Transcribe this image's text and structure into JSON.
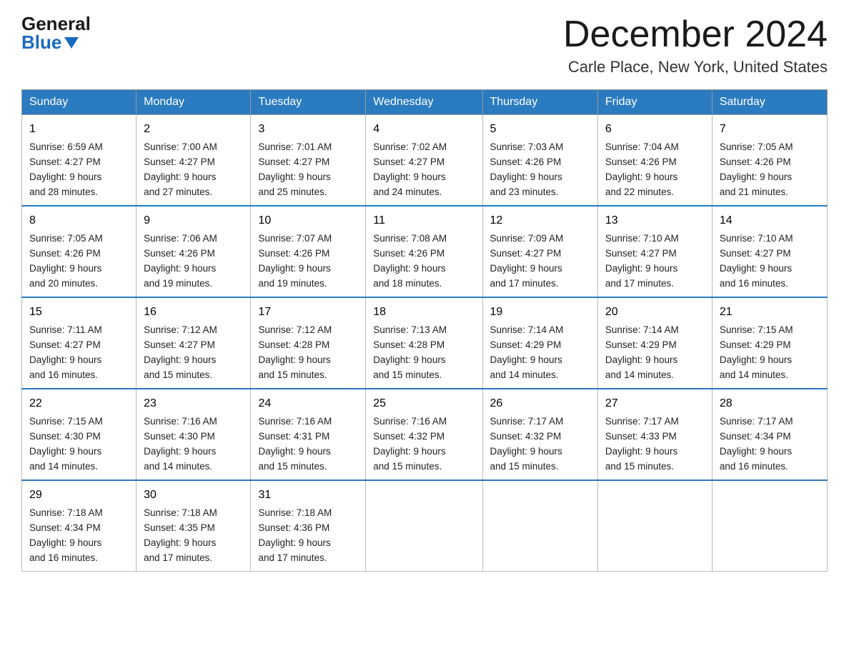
{
  "logo": {
    "general": "General",
    "blue": "Blue"
  },
  "title": "December 2024",
  "location": "Carle Place, New York, United States",
  "days_of_week": [
    "Sunday",
    "Monday",
    "Tuesday",
    "Wednesday",
    "Thursday",
    "Friday",
    "Saturday"
  ],
  "weeks": [
    [
      {
        "day": "1",
        "sunrise": "Sunrise: 6:59 AM",
        "sunset": "Sunset: 4:27 PM",
        "daylight": "Daylight: 9 hours",
        "daylight2": "and 28 minutes."
      },
      {
        "day": "2",
        "sunrise": "Sunrise: 7:00 AM",
        "sunset": "Sunset: 4:27 PM",
        "daylight": "Daylight: 9 hours",
        "daylight2": "and 27 minutes."
      },
      {
        "day": "3",
        "sunrise": "Sunrise: 7:01 AM",
        "sunset": "Sunset: 4:27 PM",
        "daylight": "Daylight: 9 hours",
        "daylight2": "and 25 minutes."
      },
      {
        "day": "4",
        "sunrise": "Sunrise: 7:02 AM",
        "sunset": "Sunset: 4:27 PM",
        "daylight": "Daylight: 9 hours",
        "daylight2": "and 24 minutes."
      },
      {
        "day": "5",
        "sunrise": "Sunrise: 7:03 AM",
        "sunset": "Sunset: 4:26 PM",
        "daylight": "Daylight: 9 hours",
        "daylight2": "and 23 minutes."
      },
      {
        "day": "6",
        "sunrise": "Sunrise: 7:04 AM",
        "sunset": "Sunset: 4:26 PM",
        "daylight": "Daylight: 9 hours",
        "daylight2": "and 22 minutes."
      },
      {
        "day": "7",
        "sunrise": "Sunrise: 7:05 AM",
        "sunset": "Sunset: 4:26 PM",
        "daylight": "Daylight: 9 hours",
        "daylight2": "and 21 minutes."
      }
    ],
    [
      {
        "day": "8",
        "sunrise": "Sunrise: 7:05 AM",
        "sunset": "Sunset: 4:26 PM",
        "daylight": "Daylight: 9 hours",
        "daylight2": "and 20 minutes."
      },
      {
        "day": "9",
        "sunrise": "Sunrise: 7:06 AM",
        "sunset": "Sunset: 4:26 PM",
        "daylight": "Daylight: 9 hours",
        "daylight2": "and 19 minutes."
      },
      {
        "day": "10",
        "sunrise": "Sunrise: 7:07 AM",
        "sunset": "Sunset: 4:26 PM",
        "daylight": "Daylight: 9 hours",
        "daylight2": "and 19 minutes."
      },
      {
        "day": "11",
        "sunrise": "Sunrise: 7:08 AM",
        "sunset": "Sunset: 4:26 PM",
        "daylight": "Daylight: 9 hours",
        "daylight2": "and 18 minutes."
      },
      {
        "day": "12",
        "sunrise": "Sunrise: 7:09 AM",
        "sunset": "Sunset: 4:27 PM",
        "daylight": "Daylight: 9 hours",
        "daylight2": "and 17 minutes."
      },
      {
        "day": "13",
        "sunrise": "Sunrise: 7:10 AM",
        "sunset": "Sunset: 4:27 PM",
        "daylight": "Daylight: 9 hours",
        "daylight2": "and 17 minutes."
      },
      {
        "day": "14",
        "sunrise": "Sunrise: 7:10 AM",
        "sunset": "Sunset: 4:27 PM",
        "daylight": "Daylight: 9 hours",
        "daylight2": "and 16 minutes."
      }
    ],
    [
      {
        "day": "15",
        "sunrise": "Sunrise: 7:11 AM",
        "sunset": "Sunset: 4:27 PM",
        "daylight": "Daylight: 9 hours",
        "daylight2": "and 16 minutes."
      },
      {
        "day": "16",
        "sunrise": "Sunrise: 7:12 AM",
        "sunset": "Sunset: 4:27 PM",
        "daylight": "Daylight: 9 hours",
        "daylight2": "and 15 minutes."
      },
      {
        "day": "17",
        "sunrise": "Sunrise: 7:12 AM",
        "sunset": "Sunset: 4:28 PM",
        "daylight": "Daylight: 9 hours",
        "daylight2": "and 15 minutes."
      },
      {
        "day": "18",
        "sunrise": "Sunrise: 7:13 AM",
        "sunset": "Sunset: 4:28 PM",
        "daylight": "Daylight: 9 hours",
        "daylight2": "and 15 minutes."
      },
      {
        "day": "19",
        "sunrise": "Sunrise: 7:14 AM",
        "sunset": "Sunset: 4:29 PM",
        "daylight": "Daylight: 9 hours",
        "daylight2": "and 14 minutes."
      },
      {
        "day": "20",
        "sunrise": "Sunrise: 7:14 AM",
        "sunset": "Sunset: 4:29 PM",
        "daylight": "Daylight: 9 hours",
        "daylight2": "and 14 minutes."
      },
      {
        "day": "21",
        "sunrise": "Sunrise: 7:15 AM",
        "sunset": "Sunset: 4:29 PM",
        "daylight": "Daylight: 9 hours",
        "daylight2": "and 14 minutes."
      }
    ],
    [
      {
        "day": "22",
        "sunrise": "Sunrise: 7:15 AM",
        "sunset": "Sunset: 4:30 PM",
        "daylight": "Daylight: 9 hours",
        "daylight2": "and 14 minutes."
      },
      {
        "day": "23",
        "sunrise": "Sunrise: 7:16 AM",
        "sunset": "Sunset: 4:30 PM",
        "daylight": "Daylight: 9 hours",
        "daylight2": "and 14 minutes."
      },
      {
        "day": "24",
        "sunrise": "Sunrise: 7:16 AM",
        "sunset": "Sunset: 4:31 PM",
        "daylight": "Daylight: 9 hours",
        "daylight2": "and 15 minutes."
      },
      {
        "day": "25",
        "sunrise": "Sunrise: 7:16 AM",
        "sunset": "Sunset: 4:32 PM",
        "daylight": "Daylight: 9 hours",
        "daylight2": "and 15 minutes."
      },
      {
        "day": "26",
        "sunrise": "Sunrise: 7:17 AM",
        "sunset": "Sunset: 4:32 PM",
        "daylight": "Daylight: 9 hours",
        "daylight2": "and 15 minutes."
      },
      {
        "day": "27",
        "sunrise": "Sunrise: 7:17 AM",
        "sunset": "Sunset: 4:33 PM",
        "daylight": "Daylight: 9 hours",
        "daylight2": "and 15 minutes."
      },
      {
        "day": "28",
        "sunrise": "Sunrise: 7:17 AM",
        "sunset": "Sunset: 4:34 PM",
        "daylight": "Daylight: 9 hours",
        "daylight2": "and 16 minutes."
      }
    ],
    [
      {
        "day": "29",
        "sunrise": "Sunrise: 7:18 AM",
        "sunset": "Sunset: 4:34 PM",
        "daylight": "Daylight: 9 hours",
        "daylight2": "and 16 minutes."
      },
      {
        "day": "30",
        "sunrise": "Sunrise: 7:18 AM",
        "sunset": "Sunset: 4:35 PM",
        "daylight": "Daylight: 9 hours",
        "daylight2": "and 17 minutes."
      },
      {
        "day": "31",
        "sunrise": "Sunrise: 7:18 AM",
        "sunset": "Sunset: 4:36 PM",
        "daylight": "Daylight: 9 hours",
        "daylight2": "and 17 minutes."
      },
      null,
      null,
      null,
      null
    ]
  ]
}
